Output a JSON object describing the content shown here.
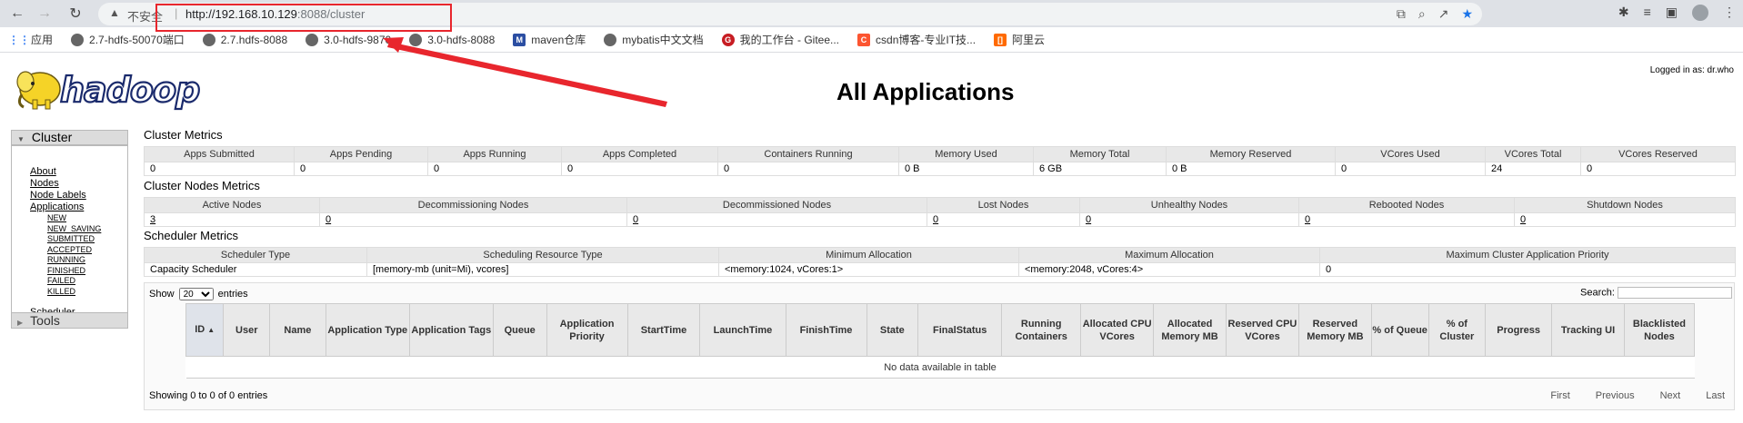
{
  "browser": {
    "security_text": "不安全",
    "url_host": "http://192.168.10.129",
    "url_rest": ":8088/cluster",
    "bookmarks": [
      {
        "icon": "apps-icon",
        "label": "应用"
      },
      {
        "icon": "globe-icon",
        "label": "2.7-hdfs-50070端口"
      },
      {
        "icon": "globe-icon",
        "label": "2.7.hdfs-8088"
      },
      {
        "icon": "globe-icon",
        "label": "3.0-hdfs-9870"
      },
      {
        "icon": "globe-icon",
        "label": "3.0-hdfs-8088"
      },
      {
        "icon": "maven-icon",
        "label": "maven仓库"
      },
      {
        "icon": "github-icon",
        "label": "mybatis中文文档"
      },
      {
        "icon": "gitee-icon",
        "label": "我的工作台 - Gitee..."
      },
      {
        "icon": "csdn-icon",
        "label": "csdn博客-专业IT技..."
      },
      {
        "icon": "aliyun-icon",
        "label": "阿里云"
      }
    ]
  },
  "header": {
    "title": "All Applications",
    "logged_in": "Logged in as: dr.who"
  },
  "sidebar": {
    "cluster": "Cluster",
    "links": [
      "About",
      "Nodes",
      "Node Labels",
      "Applications"
    ],
    "app_states": [
      "NEW",
      "NEW_SAVING",
      "SUBMITTED",
      "ACCEPTED",
      "RUNNING",
      "FINISHED",
      "FAILED",
      "KILLED"
    ],
    "scheduler": "Scheduler",
    "tools": "Tools"
  },
  "cluster_metrics": {
    "title": "Cluster Metrics",
    "headers": [
      "Apps Submitted",
      "Apps Pending",
      "Apps Running",
      "Apps Completed",
      "Containers Running",
      "Memory Used",
      "Memory Total",
      "Memory Reserved",
      "VCores Used",
      "VCores Total",
      "VCores Reserved"
    ],
    "values": [
      "0",
      "0",
      "0",
      "0",
      "0",
      "0 B",
      "6 GB",
      "0 B",
      "0",
      "24",
      "0"
    ]
  },
  "nodes_metrics": {
    "title": "Cluster Nodes Metrics",
    "headers": [
      "Active Nodes",
      "Decommissioning Nodes",
      "Decommissioned Nodes",
      "Lost Nodes",
      "Unhealthy Nodes",
      "Rebooted Nodes",
      "Shutdown Nodes"
    ],
    "values": [
      "3",
      "0",
      "0",
      "0",
      "0",
      "0",
      "0"
    ]
  },
  "scheduler_metrics": {
    "title": "Scheduler Metrics",
    "headers": [
      "Scheduler Type",
      "Scheduling Resource Type",
      "Minimum Allocation",
      "Maximum Allocation",
      "Maximum Cluster Application Priority"
    ],
    "values": [
      "Capacity Scheduler",
      "[memory-mb (unit=Mi), vcores]",
      "<memory:1024, vCores:1>",
      "<memory:2048, vCores:4>",
      "0"
    ]
  },
  "apps": {
    "show_label": "Show",
    "entries_label": "entries",
    "page_size": "20",
    "search_label": "Search:",
    "columns": [
      "ID",
      "User",
      "Name",
      "Application Type",
      "Application Tags",
      "Queue",
      "Application Priority",
      "StartTime",
      "LaunchTime",
      "FinishTime",
      "State",
      "FinalStatus",
      "Running Containers",
      "Allocated CPU VCores",
      "Allocated Memory MB",
      "Reserved CPU VCores",
      "Reserved Memory MB",
      "% of Queue",
      "% of Cluster",
      "Progress",
      "Tracking UI",
      "Blacklisted Nodes"
    ],
    "empty_text": "No data available in table",
    "showing": "Showing 0 to 0 of 0 entries",
    "pager": [
      "First",
      "Previous",
      "Next",
      "Last"
    ]
  },
  "colors": {
    "annotation_red": "#e8262d",
    "logo_yellow": "#f5d327"
  }
}
